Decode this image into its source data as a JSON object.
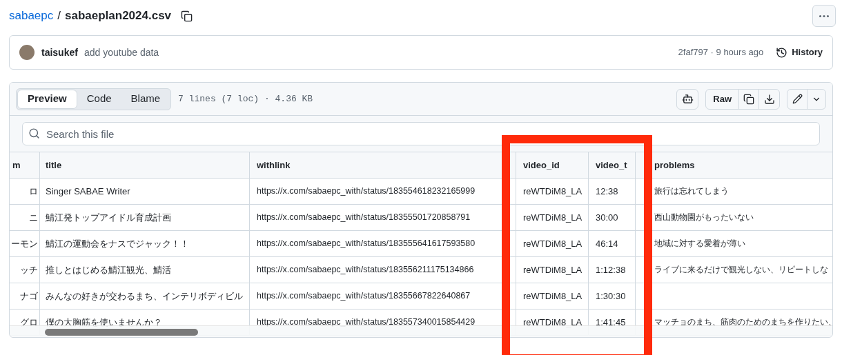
{
  "breadcrumb": {
    "owner": "sabaepc",
    "separator": "/",
    "file": "sabaeplan2024.csv"
  },
  "commit": {
    "author": "taisukef",
    "message": "add youtube data",
    "meta": "2faf797 · 9 hours ago",
    "history": "History"
  },
  "view_tabs": [
    {
      "label": "Preview",
      "selected": true
    },
    {
      "label": "Code",
      "selected": false
    },
    {
      "label": "Blame",
      "selected": false
    }
  ],
  "file_info": "7 lines (7 loc) · 4.36 KB",
  "raw_button": "Raw",
  "search": {
    "placeholder": "Search this file"
  },
  "table": {
    "columns": [
      "m",
      "title",
      "withlink",
      "video_id",
      "video_t",
      "problems"
    ],
    "rows": [
      [
        "ロ",
        "Singer SABAE Writer",
        "https://x.com/sabaepc_with/status/183554618232165999",
        "reWTDiM8_LA",
        "12:38",
        "旅行は忘れてしまう"
      ],
      [
        "ニ",
        "鯖江発トップアイドル育成計画",
        "https://x.com/sabaepc_with/status/18355501720858791",
        "reWTDiM8_LA",
        "30:00",
        "西山動物園がもったいない"
      ],
      [
        "ーモン",
        "鯖江の運動会をナスでジャック！！",
        "https://x.com/sabaepc_with/status/183555641617593580",
        "reWTDiM8_LA",
        "46:14",
        "地域に対する愛着が薄い"
      ],
      [
        "ッチ",
        "推しとはじめる鯖江観光、鯖活",
        "https://x.com/sabaepc_with/status/183556211175134866",
        "reWTDiM8_LA",
        "1:12:38",
        "ライブに来るだけで観光しない、リピートしな"
      ],
      [
        "ナゴ",
        "みんなの好きが交わるまち、インテリボディビル",
        "https://x.com/sabaepc_with/status/18355667822640867",
        "reWTDiM8_LA",
        "1:30:30",
        ""
      ],
      [
        "グロ",
        "僕の大胸筋を使いませんか？",
        "https://x.com/sabaepc_with/status/183557340015854429",
        "reWTDiM8_LA",
        "1:41:45",
        "マッチョのまち、筋肉のためのまちを作りたい、"
      ]
    ]
  }
}
